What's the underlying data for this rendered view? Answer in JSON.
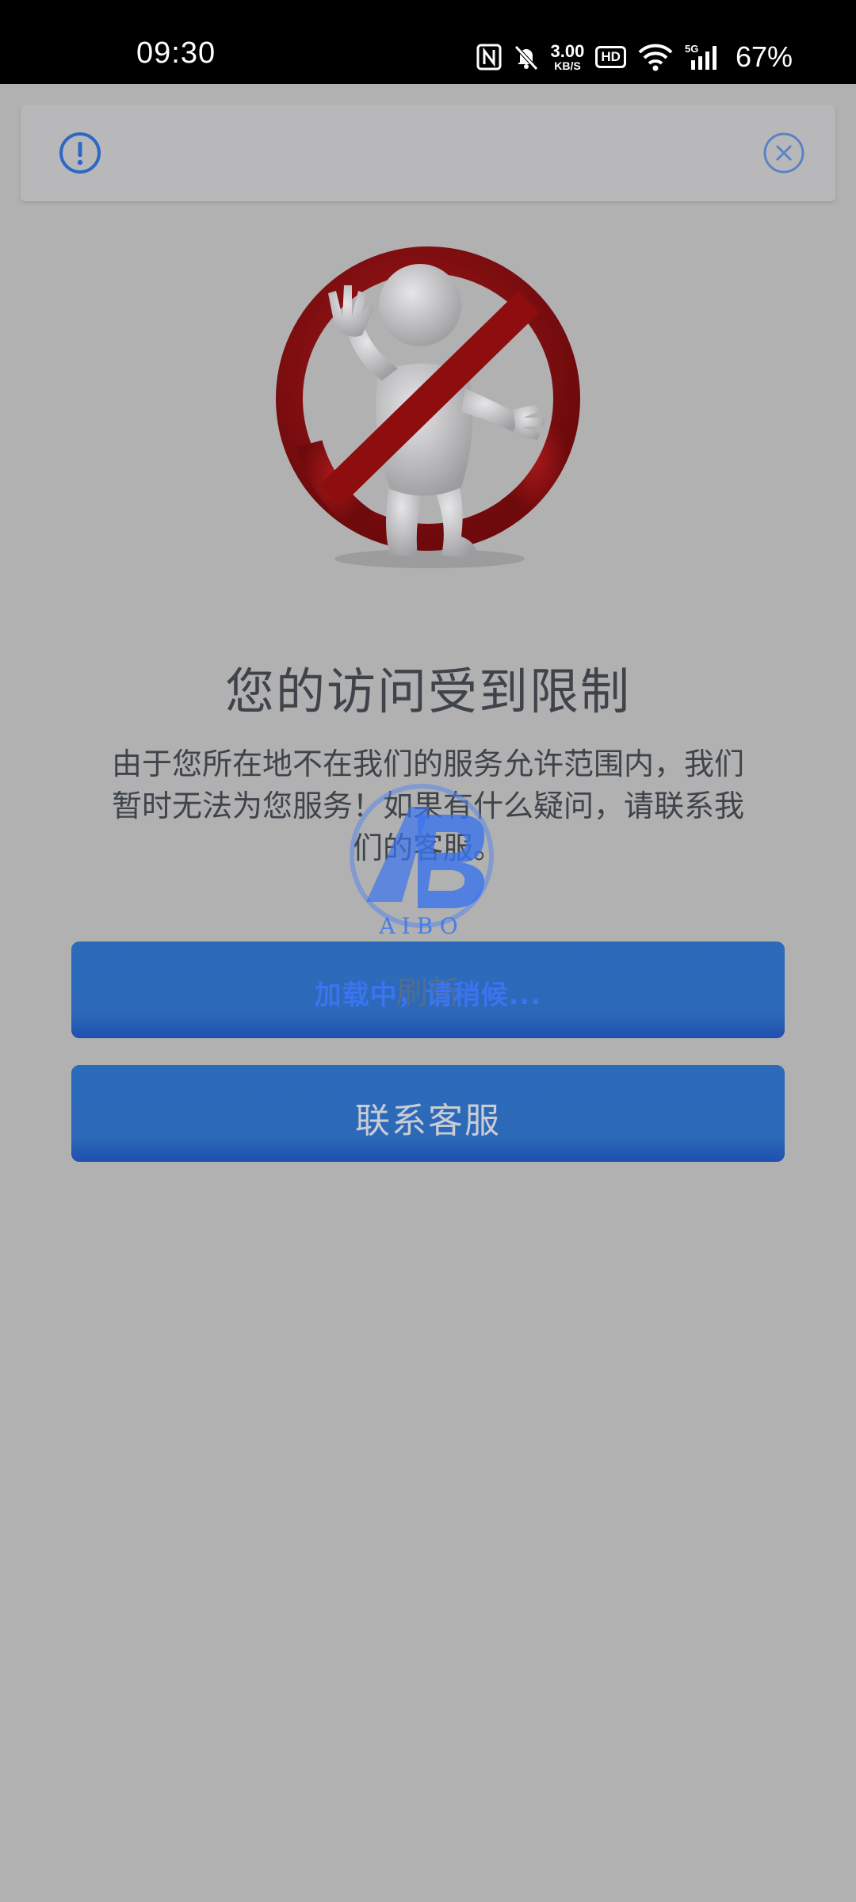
{
  "status_bar": {
    "time": "09:30",
    "network_speed_value": "3.00",
    "network_speed_unit": "KB/S",
    "hd_label": "HD",
    "signal_label": "5G",
    "battery": "67%",
    "icons": [
      "nfc-icon",
      "mute-icon",
      "wifi-icon",
      "signal-icon"
    ]
  },
  "notice": {
    "icons": [
      "info-icon",
      "close-icon"
    ],
    "accent_color": "#2f67c2"
  },
  "content": {
    "title": "您的访问受到限制",
    "message": "由于您所在地不在我们的服务允许范围内，我们暂时无法为您服务！如果有什么疑问，请联系我们的客服。",
    "illustration": "no-entry-figure"
  },
  "watermark": {
    "logo_text": "AIBO"
  },
  "buttons": {
    "refresh_label": "刷新",
    "loading_text": "加载中，请稍候...",
    "contact_label": "联系客服"
  },
  "colors": {
    "background": "#b1b1b1",
    "button": "#2c69b9",
    "title_text": "#3f444b",
    "prohibition_red": "#8e0d0f"
  }
}
